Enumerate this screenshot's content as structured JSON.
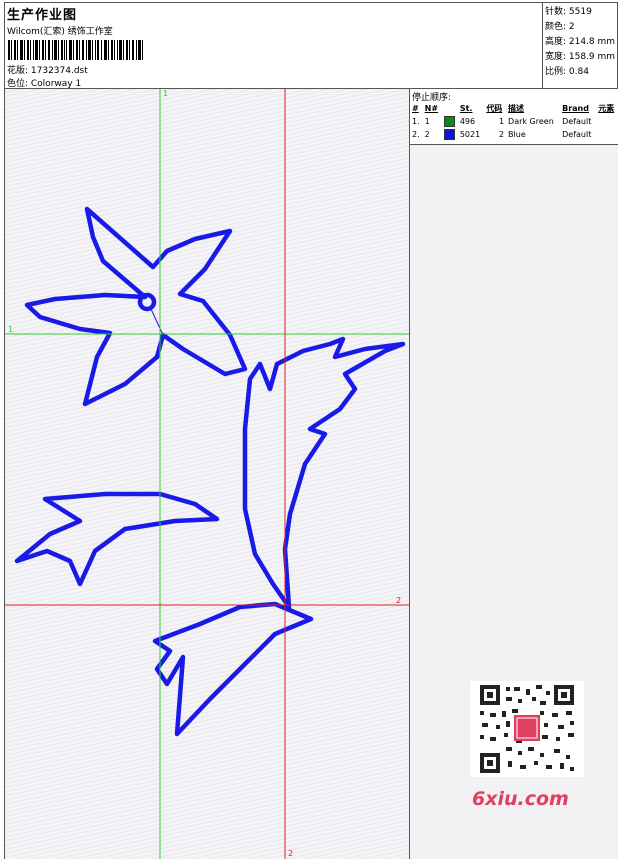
{
  "header": {
    "title": "生产作业图",
    "subtitle": "Wilcom(汇索) 绣饰工作室",
    "design_label": "花版: 1732374.dst",
    "colorway_label": "色位: Colorway 1"
  },
  "stats": {
    "stitches": "针数: 5519",
    "colors": "颜色: 2",
    "height": "高度: 214.8 mm",
    "width": "宽度: 158.9 mm",
    "scale": "比例: 0.84"
  },
  "stop_sequence": {
    "heading": "停止顺序:",
    "columns": [
      "#",
      "N#",
      "St.",
      "代码",
      "描述",
      "Brand",
      "元素"
    ],
    "rows": [
      {
        "num": "1.",
        "n": "1",
        "color": "#118811",
        "st": "496",
        "code": "1",
        "desc": "Dark Green",
        "brand": "Default"
      },
      {
        "num": "2.",
        "n": "2",
        "color": "#1010dd",
        "st": "5021",
        "code": "2",
        "desc": "Blue",
        "brand": "Default"
      }
    ]
  },
  "axes": {
    "green_label_top": "1",
    "green_label_left": "1",
    "red_label_right": "2",
    "red_label_bottom": "2"
  },
  "watermark": {
    "text": "6xiu.com"
  },
  "colors": {
    "blue": "#1a1ae8",
    "green_axis": "#33cc33",
    "red_axis": "#e02020"
  }
}
